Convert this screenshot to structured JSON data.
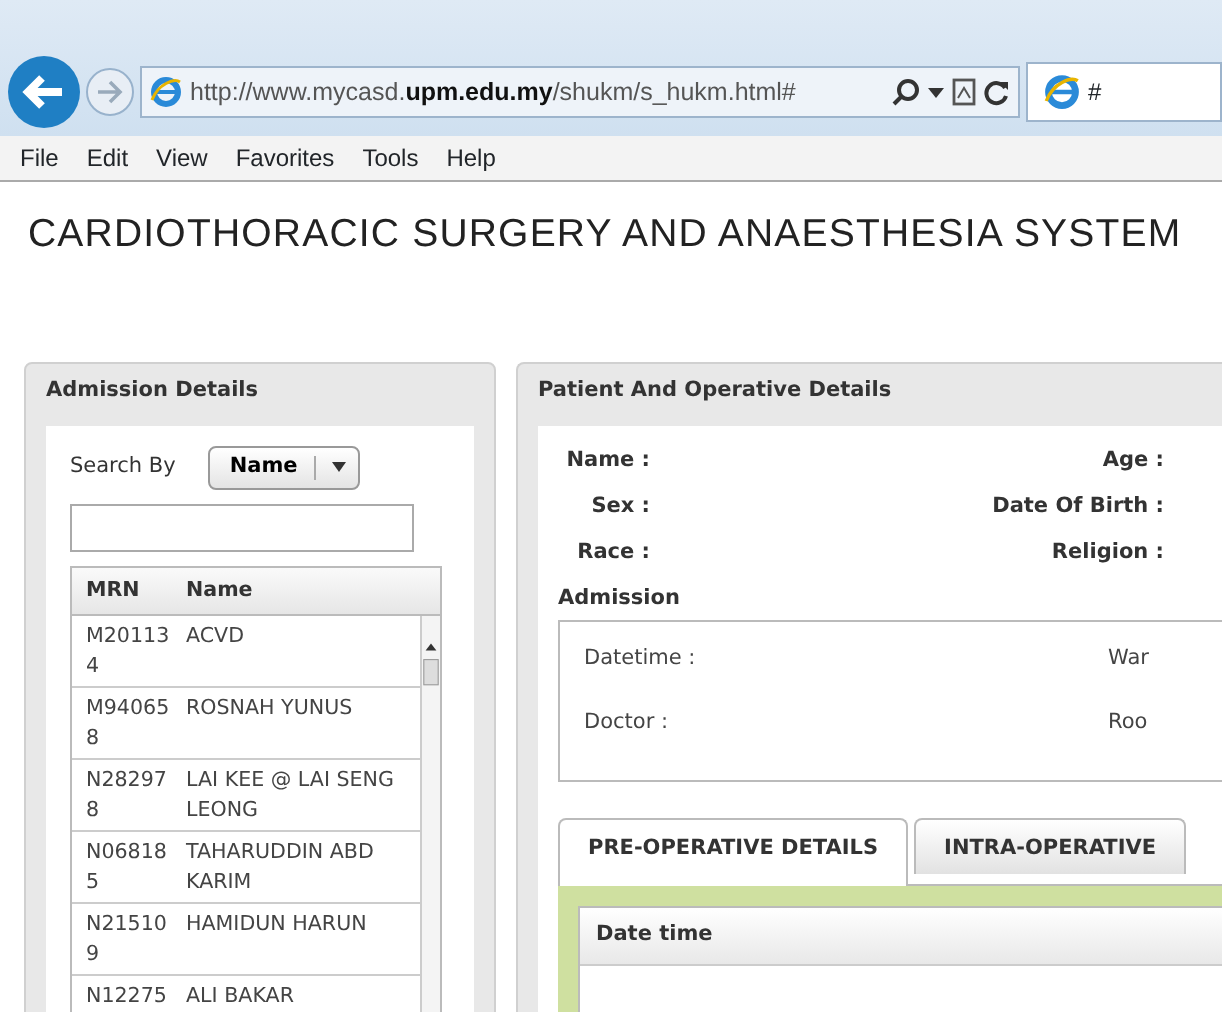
{
  "browser": {
    "url": "http://www.mycasd.**upm.edu.my**/shukm/s_hukm.html#",
    "tab_title": "#"
  },
  "menu": [
    "File",
    "Edit",
    "View",
    "Favorites",
    "Tools",
    "Help"
  ],
  "page_title": "CARDIOTHORACIC SURGERY AND ANAESTHESIA SYSTEM",
  "admission_panel": {
    "title": "Admission Details",
    "search_label": "Search By",
    "search_by": "Name",
    "columns": [
      "MRN",
      "Name"
    ],
    "rows": [
      {
        "mrn": "M201134",
        "name": "ACVD"
      },
      {
        "mrn": "M940658",
        "name": "ROSNAH YUNUS"
      },
      {
        "mrn": "N282978",
        "name": "LAI KEE @ LAI SENG LEONG"
      },
      {
        "mrn": "N068185",
        "name": "TAHARUDDIN ABD KARIM"
      },
      {
        "mrn": "N215109",
        "name": "HAMIDUN HARUN"
      },
      {
        "mrn": "N12275",
        "name": "ALI BAKAR"
      }
    ]
  },
  "patient_panel": {
    "title": "Patient And Operative Details",
    "fields": [
      [
        "Name :",
        "Age :"
      ],
      [
        "Sex :",
        "Date Of Birth :"
      ],
      [
        "Race :",
        "Religion :"
      ]
    ],
    "admission_title": "Admission",
    "admission_fields": [
      [
        "Datetime :",
        "War"
      ],
      [
        "Doctor :",
        "Roo"
      ]
    ],
    "tabs": [
      {
        "label": "PRE-OPERATIVE DETAILS",
        "selected": true
      },
      {
        "label": "INTRA-OPERATIVE",
        "selected": false
      }
    ],
    "table_columns": [
      "Date time"
    ]
  }
}
